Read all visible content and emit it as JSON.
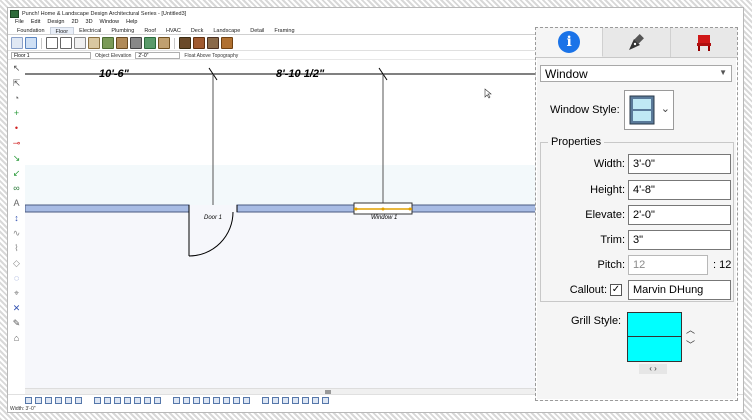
{
  "window_title": "Punch! Home & Landscape Design Architectural Series - [Untitled3]",
  "menus": [
    "File",
    "Edit",
    "Design",
    "2D",
    "3D",
    "Window",
    "Help"
  ],
  "ribbon_tabs": [
    "Foundation",
    "Floor",
    "Electrical",
    "Plumbing",
    "Roof",
    "HVAC",
    "Deck",
    "Landscape",
    "Detail",
    "Framing"
  ],
  "active_ribbon_tab": "Floor",
  "options_bar": {
    "floor": "Floor 1",
    "object_elevation_label": "Object Elevation",
    "object_elevation_value": "2'-0\"",
    "topography_label": "Float Above Topography"
  },
  "drawing": {
    "dim_left": "10'-6\"",
    "dim_right": "8'-10 1/2\"",
    "door_label": "Door 1",
    "window_label": "Window 1",
    "wall_color": "#a8bce4",
    "door_color": "#000000"
  },
  "status": "Width: 3'-0\"",
  "panel": {
    "tabs": [
      "info-icon",
      "pen-nib-icon",
      "chair-icon"
    ],
    "object_type": "Window",
    "window_style_label": "Window Style:",
    "properties_title": "Properties",
    "properties": [
      {
        "label": "Width:",
        "value": "3'-0\""
      },
      {
        "label": "Height:",
        "value": "4'-8\""
      },
      {
        "label": "Elevate:",
        "value": "2'-0\""
      },
      {
        "label": "Trim:",
        "value": "3\""
      }
    ],
    "pitch_label": "Pitch:",
    "pitch_value": "12",
    "pitch_suffix": ": 12",
    "callout_label": "Callout:",
    "callout_checked": true,
    "callout_value": "Marvin DHung",
    "grill_style_label": "Grill Style:",
    "grill_color": "#00ffff",
    "accent_color": "#1a73e8"
  }
}
